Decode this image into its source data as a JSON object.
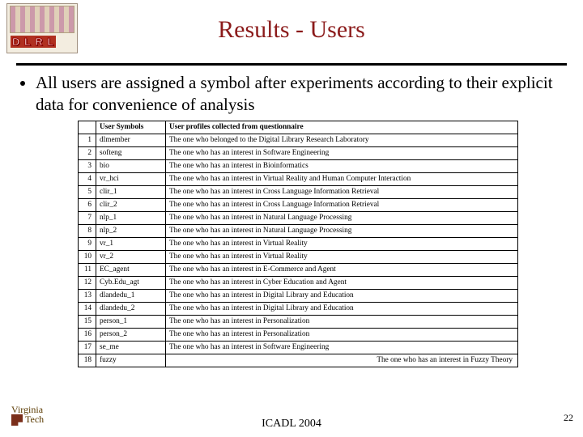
{
  "title": "Results - Users",
  "bullet": "All users are assigned a symbol after experiments according to their explicit data for convenience of analysis",
  "table": {
    "h1": "User Symbols",
    "h2": "User profiles collected from questionnaire",
    "rows": [
      {
        "n": "1",
        "s": "dlmember",
        "d": "The one who belonged to the Digital Library Research Laboratory"
      },
      {
        "n": "2",
        "s": "softeng",
        "d": "The one who has an interest in Software Engineering"
      },
      {
        "n": "3",
        "s": "bio",
        "d": "The one who has an interest in Bioinformatics"
      },
      {
        "n": "4",
        "s": "vr_hci",
        "d": "The one who has an interest in Virtual Reality and Human Computer Interaction"
      },
      {
        "n": "5",
        "s": "clir_1",
        "d": "The one who has an interest in Cross Language Information Retrieval"
      },
      {
        "n": "6",
        "s": "clir_2",
        "d": "The one who has an interest in Cross Language Information Retrieval"
      },
      {
        "n": "7",
        "s": "nlp_1",
        "d": "The one who has an interest in Natural Language Processing"
      },
      {
        "n": "8",
        "s": "nlp_2",
        "d": "The one who has an interest in Natural Language Processing"
      },
      {
        "n": "9",
        "s": "vr_1",
        "d": "The one who has an interest in Virtual Reality"
      },
      {
        "n": "10",
        "s": "vr_2",
        "d": "The one who has an interest in Virtual Reality"
      },
      {
        "n": "11",
        "s": "EC_agent",
        "d": "The one who has an interest in E-Commerce and Agent"
      },
      {
        "n": "12",
        "s": "Cyb.Edu_agt",
        "d": "The one who has an interest in Cyber Education and Agent"
      },
      {
        "n": "13",
        "s": "dlandedu_1",
        "d": "The one who has an interest in Digital Library and Education"
      },
      {
        "n": "14",
        "s": "dlandedu_2",
        "d": "The one who has an interest in Digital Library and Education"
      },
      {
        "n": "15",
        "s": "person_1",
        "d": "The one who has an interest in Personalization"
      },
      {
        "n": "16",
        "s": "person_2",
        "d": "The one who has an interest in Personalization"
      },
      {
        "n": "17",
        "s": "se_me",
        "d": "The one who has an interest in Software Engineering"
      },
      {
        "n": "18",
        "s": "fuzzy",
        "d": "The one who has an interest in Fuzzy Theory"
      }
    ]
  },
  "footer": {
    "logo1": "Virginia",
    "logo2": "Tech",
    "conf": "ICADL 2004",
    "page": "22"
  }
}
